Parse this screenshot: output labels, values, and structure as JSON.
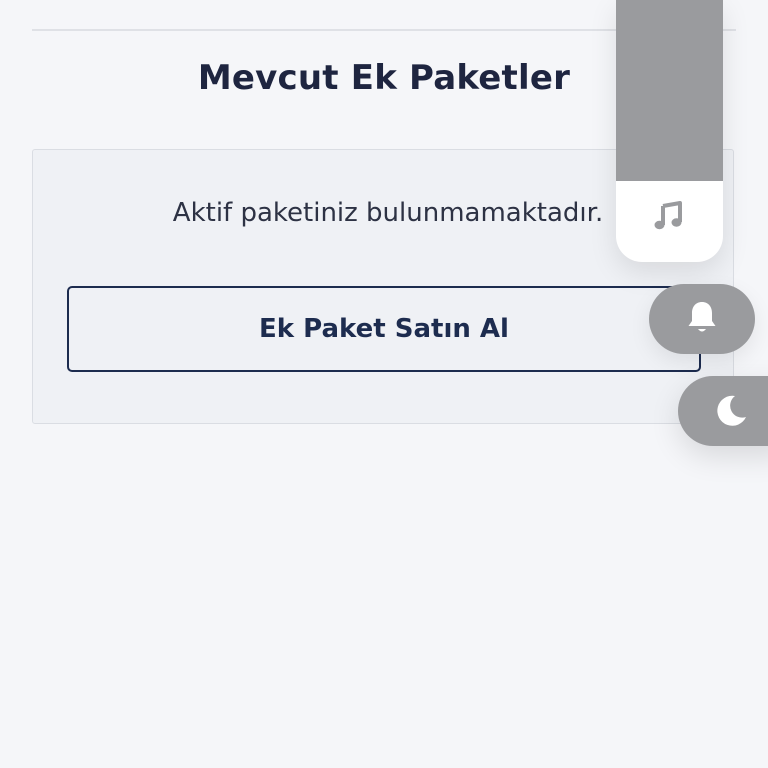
{
  "section": {
    "title": "Mevcut Ek Paketler"
  },
  "card": {
    "empty_message": "Aktif paketiniz bulunmamaktadır.",
    "buy_button_label": "Ek Paket Satın Al"
  },
  "floating_controls": {
    "music_icon": "music-note-icon",
    "bell_icon": "bell-icon",
    "moon_icon": "moon-icon"
  },
  "colors": {
    "background": "#f5f6f9",
    "title_text": "#1e2540",
    "button_border": "#1d2c4f",
    "control_gray": "#9a9b9e"
  }
}
